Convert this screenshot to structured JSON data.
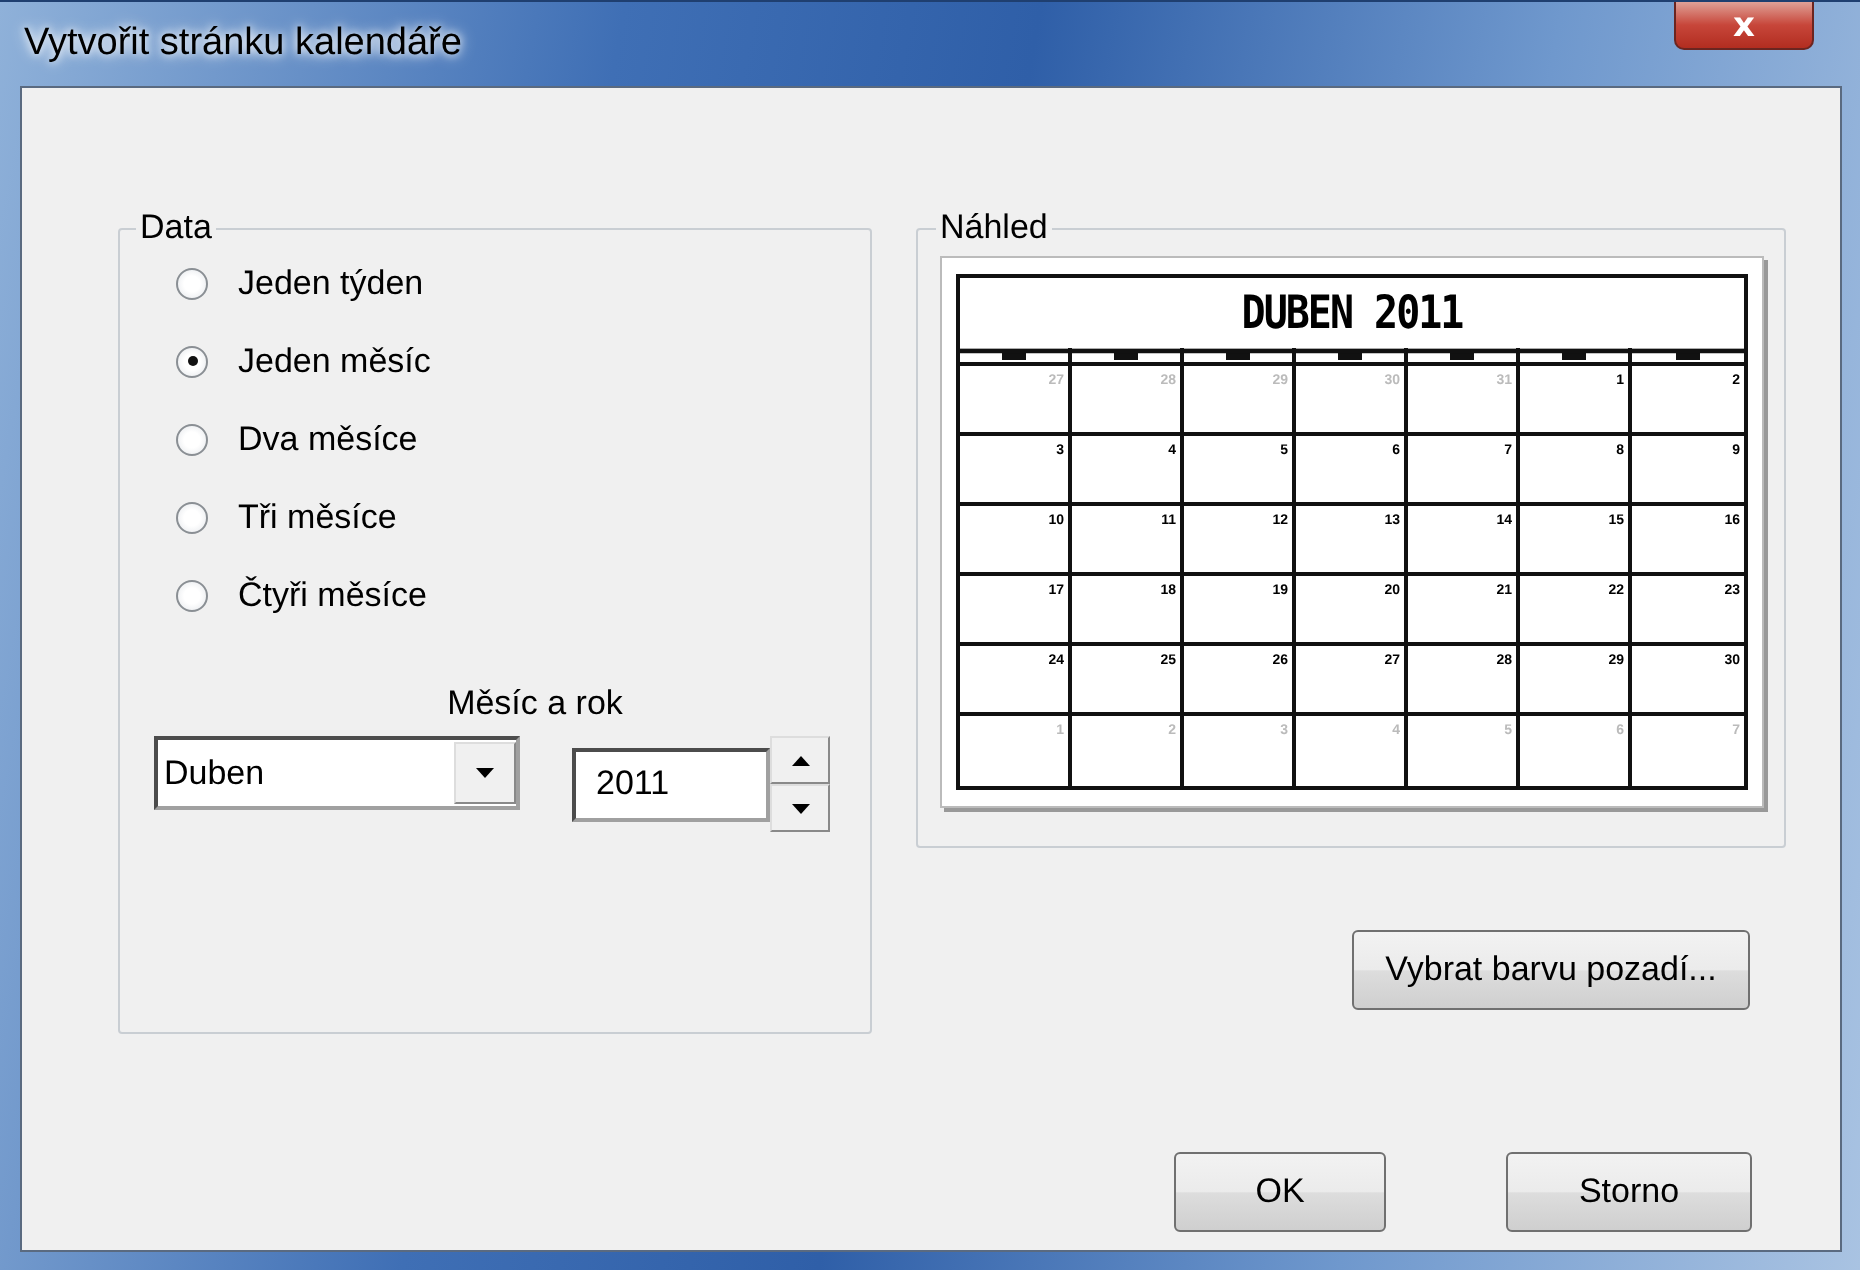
{
  "window": {
    "title": "Vytvořit stránku kalendáře",
    "close": "x"
  },
  "data_group": {
    "title": "Data",
    "options": [
      {
        "label": "Jeden týden",
        "selected": false
      },
      {
        "label": "Jeden měsíc",
        "selected": true
      },
      {
        "label": "Dva měsíce",
        "selected": false
      },
      {
        "label": "Tři měsíce",
        "selected": false
      },
      {
        "label": "Čtyři měsíce",
        "selected": false
      }
    ],
    "month_year_label": "Měsíc a rok",
    "month_select": {
      "value": "Duben"
    },
    "year_spinner": {
      "value": "2011"
    }
  },
  "preview_group": {
    "title": "Náhled",
    "calendar": {
      "title": "DUBEN 2011",
      "weeks": [
        [
          {
            "day": "27",
            "muted": true
          },
          {
            "day": "28",
            "muted": true
          },
          {
            "day": "29",
            "muted": true
          },
          {
            "day": "30",
            "muted": true
          },
          {
            "day": "31",
            "muted": true
          },
          {
            "day": "1",
            "muted": false
          },
          {
            "day": "2",
            "muted": false
          }
        ],
        [
          {
            "day": "3",
            "muted": false
          },
          {
            "day": "4",
            "muted": false
          },
          {
            "day": "5",
            "muted": false
          },
          {
            "day": "6",
            "muted": false
          },
          {
            "day": "7",
            "muted": false
          },
          {
            "day": "8",
            "muted": false
          },
          {
            "day": "9",
            "muted": false
          }
        ],
        [
          {
            "day": "10",
            "muted": false
          },
          {
            "day": "11",
            "muted": false
          },
          {
            "day": "12",
            "muted": false
          },
          {
            "day": "13",
            "muted": false
          },
          {
            "day": "14",
            "muted": false
          },
          {
            "day": "15",
            "muted": false
          },
          {
            "day": "16",
            "muted": false
          }
        ],
        [
          {
            "day": "17",
            "muted": false
          },
          {
            "day": "18",
            "muted": false
          },
          {
            "day": "19",
            "muted": false
          },
          {
            "day": "20",
            "muted": false
          },
          {
            "day": "21",
            "muted": false
          },
          {
            "day": "22",
            "muted": false
          },
          {
            "day": "23",
            "muted": false
          }
        ],
        [
          {
            "day": "24",
            "muted": false
          },
          {
            "day": "25",
            "muted": false
          },
          {
            "day": "26",
            "muted": false
          },
          {
            "day": "27",
            "muted": false
          },
          {
            "day": "28",
            "muted": false
          },
          {
            "day": "29",
            "muted": false
          },
          {
            "day": "30",
            "muted": false
          }
        ],
        [
          {
            "day": "1",
            "muted": true
          },
          {
            "day": "2",
            "muted": true
          },
          {
            "day": "3",
            "muted": true
          },
          {
            "day": "4",
            "muted": true
          },
          {
            "day": "5",
            "muted": true
          },
          {
            "day": "6",
            "muted": true
          },
          {
            "day": "7",
            "muted": true
          }
        ]
      ]
    }
  },
  "background_button": "Vybrat barvu pozadí...",
  "buttons": [
    "OK",
    "Storno"
  ]
}
